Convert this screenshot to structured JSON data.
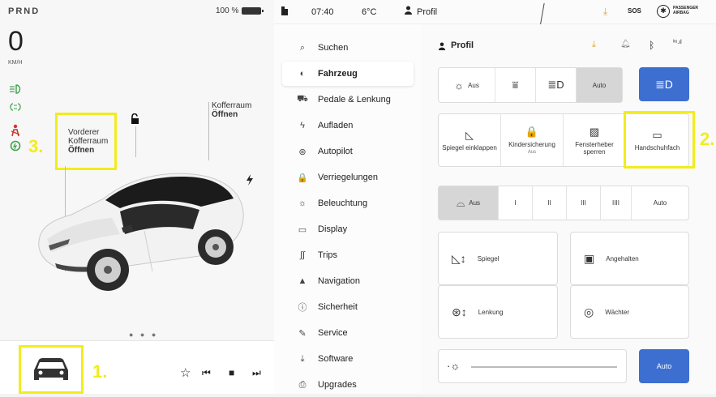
{
  "status_left": {
    "gear": "PRND",
    "battery": "100 %"
  },
  "speed": {
    "value": "0",
    "unit": "KM/H"
  },
  "trunk": {
    "front_line1": "Vorderer",
    "front_line2": "Kofferraum",
    "front_state": "Öffnen",
    "rear_line1": "Kofferraum",
    "rear_state": "Öffnen"
  },
  "callouts": {
    "one": "1.",
    "two": "2.",
    "three": "3."
  },
  "pager": "● ● ●",
  "media": {
    "star": "☆",
    "prev": "⏮",
    "stop": "■",
    "next": "⏭"
  },
  "status_bar": {
    "time": "07:40",
    "temp": "6°C",
    "profile": "Profil",
    "sos": "SOS",
    "airbag_line1": "PASSENGER",
    "airbag_line2": "AIRBAG"
  },
  "menu": [
    {
      "icon": "search-icon",
      "glyph": "⌕",
      "label": "Suchen"
    },
    {
      "icon": "toggle-icon",
      "glyph": "◐",
      "label": "Fahrzeug",
      "active": true
    },
    {
      "icon": "car-seat-icon",
      "glyph": "⛟",
      "label": "Pedale & Lenkung"
    },
    {
      "icon": "bolt-icon",
      "glyph": "ϟ",
      "label": "Aufladen"
    },
    {
      "icon": "steering-wheel-icon",
      "glyph": "⊛",
      "label": "Autopilot"
    },
    {
      "icon": "lock-icon",
      "glyph": "🔒",
      "label": "Verriegelungen"
    },
    {
      "icon": "sun-icon",
      "glyph": "☼",
      "label": "Beleuchtung"
    },
    {
      "icon": "display-icon",
      "glyph": "▭",
      "label": "Display"
    },
    {
      "icon": "trips-icon",
      "glyph": "∫∫",
      "label": "Trips"
    },
    {
      "icon": "navigation-icon",
      "glyph": "▲",
      "label": "Navigation"
    },
    {
      "icon": "safety-icon",
      "glyph": "ⓘ",
      "label": "Sicherheit"
    },
    {
      "icon": "wrench-icon",
      "glyph": "✎",
      "label": "Service"
    },
    {
      "icon": "download-icon",
      "glyph": "⤓",
      "label": "Software"
    },
    {
      "icon": "bag-icon",
      "glyph": "⎙",
      "label": "Upgrades"
    }
  ],
  "content": {
    "profile_label": "Profil",
    "lights": [
      {
        "icon": "sun-icon",
        "glyph": "☼",
        "label": "Aus"
      },
      {
        "icon": "parking-lights-icon",
        "glyph": "⩸",
        "label": ""
      },
      {
        "icon": "low-beam-icon",
        "glyph": "≣D",
        "label": ""
      },
      {
        "icon": "",
        "glyph": "",
        "label": "Auto",
        "selected": true
      }
    ],
    "headlight_button": "≣D",
    "actions": [
      {
        "icon": "mirror-icon",
        "glyph": "◺",
        "label": "Spiegel einklappen",
        "sub": ""
      },
      {
        "icon": "child-lock-icon",
        "glyph": "🔒",
        "label": "Kindersicherung",
        "sub": "Aus"
      },
      {
        "icon": "window-lock-icon",
        "glyph": "▨",
        "label": "Fensterheber sperren",
        "sub": ""
      },
      {
        "icon": "glovebox-icon",
        "glyph": "▭",
        "label": "Handschuhfach",
        "sub": ""
      }
    ],
    "wipers": [
      {
        "icon": "wiper-icon",
        "glyph": "⌓",
        "label": "Aus",
        "selected": true
      },
      {
        "label": "I"
      },
      {
        "label": "II"
      },
      {
        "label": "III"
      },
      {
        "label": "IIII"
      },
      {
        "label": "Auto"
      }
    ],
    "tiles": [
      {
        "icon": "mirror-adjust-icon",
        "glyph": "◺↕",
        "label": "Spiegel"
      },
      {
        "icon": "dashcam-icon",
        "glyph": "▣",
        "label": "Angehalten"
      },
      {
        "icon": "steering-adjust-icon",
        "glyph": "⊛↕",
        "label": "Lenkung"
      },
      {
        "icon": "sentry-icon",
        "glyph": "◎",
        "label": "Wächter"
      }
    ],
    "brightness_auto": "Auto"
  }
}
